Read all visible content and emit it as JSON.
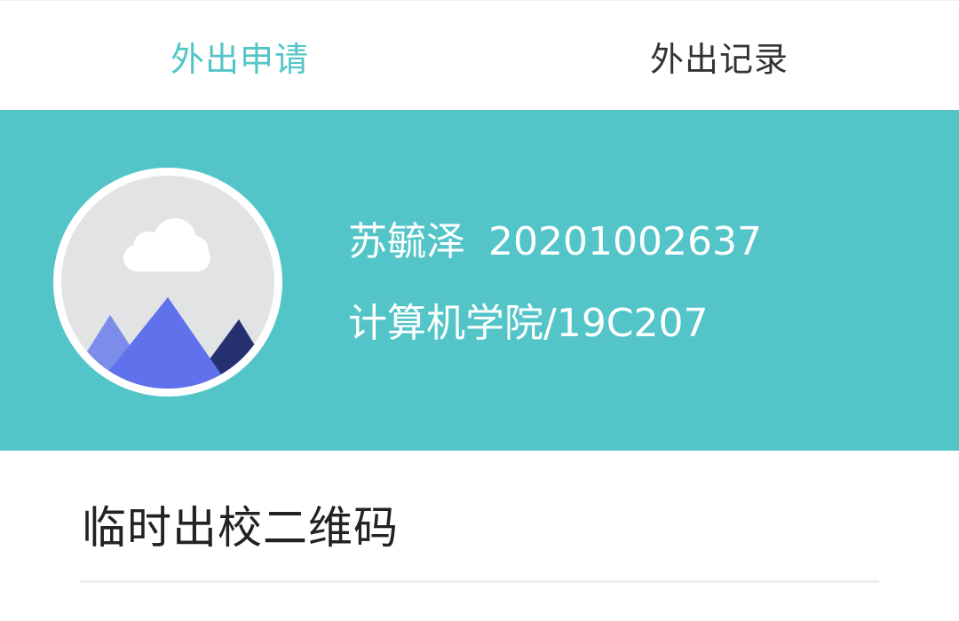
{
  "tabs": [
    {
      "label": "外出申请",
      "active": true
    },
    {
      "label": "外出记录",
      "active": false
    }
  ],
  "colors": {
    "accent": "#53c5c8",
    "active_tab_text": "#53c5c8",
    "inactive_tab_text": "#333333",
    "profile_bg": "#53c5c8"
  },
  "profile": {
    "avatar_icon": "image-placeholder-icon",
    "name": "苏毓泽",
    "student_id": "20201002637",
    "department_class": "计算机学院/19C207"
  },
  "section": {
    "title": "临时出校二维码"
  }
}
